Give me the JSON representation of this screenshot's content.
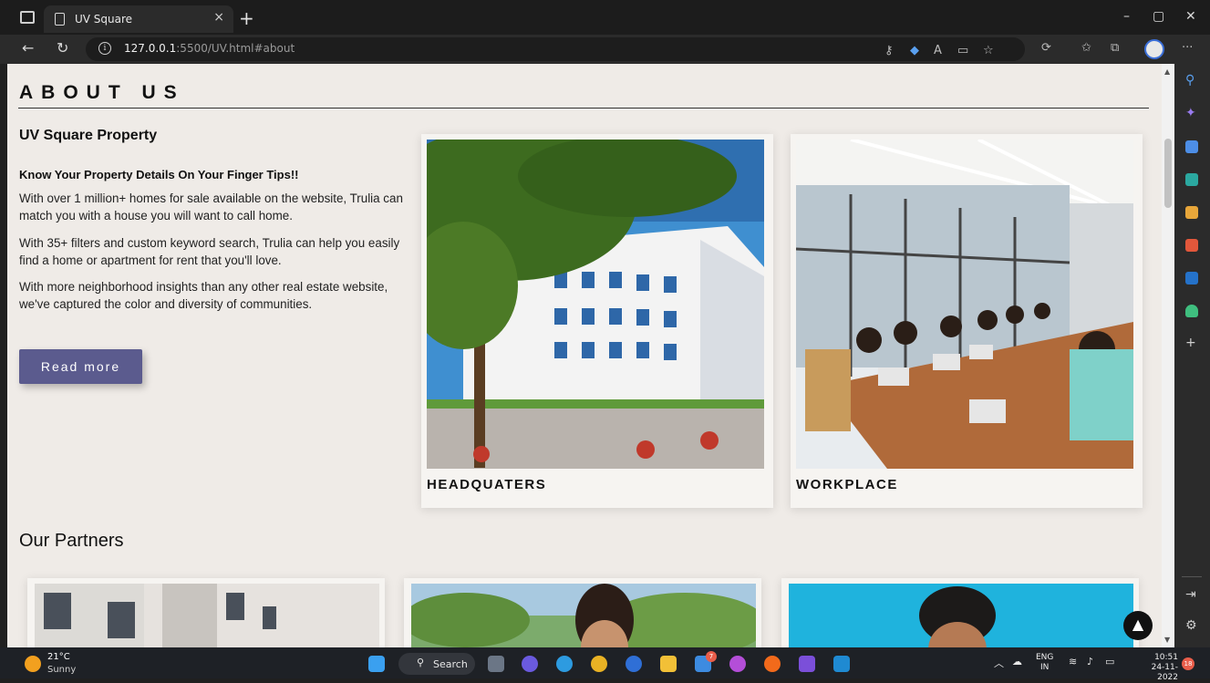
{
  "browser": {
    "tab_title": "UV Square",
    "tab_close": "×",
    "new_tab": "+",
    "url_host": "127.0.0.1",
    "url_rest": ":5500/UV.html#about",
    "window_controls": {
      "minimize": "–",
      "maximize": "▢",
      "close": "✕"
    },
    "nav": {
      "back": "←",
      "reload": "↻",
      "more": "···"
    }
  },
  "page": {
    "about_heading": "ABOUT US",
    "company": "UV Square Property",
    "tagline": "Know Your Property Details On Your Finger Tips!!",
    "paragraphs": [
      "With over 1 million+ homes for sale available on the website, Trulia can match you with a house you will want to call home.",
      "With 35+ filters and custom keyword search, Trulia can help you easily find a home or apartment for rent that you'll love.",
      "With more neighborhood insights than any other real estate website, we've captured the color and diversity of communities."
    ],
    "read_more": "Read more",
    "cards": [
      {
        "caption": "HEADQUATERS"
      },
      {
        "caption": "WORKPLACE"
      }
    ],
    "partners_heading": "Our Partners",
    "to_top": "▲"
  },
  "taskbar": {
    "temperature": "21°C",
    "condition": "Sunny",
    "search_label": "Search",
    "lang_top": "ENG",
    "lang_bottom": "IN",
    "time": "10:51",
    "date": "24-11-2022",
    "notifications": "18",
    "mail_badge": "7"
  },
  "colors": {
    "page_bg": "#efebe7",
    "button": "#5b5b8e",
    "chrome_dark": "#1c1c1c",
    "taskbar": "#1e2126"
  }
}
